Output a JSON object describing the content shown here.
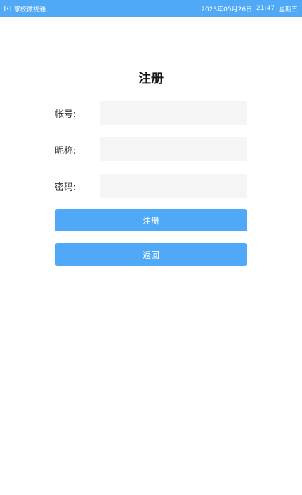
{
  "status_bar": {
    "app_icon": "app-logo-icon",
    "app_name": "家校微视通",
    "date": "2023年05月26日",
    "time": "21:47",
    "weekday": "星期五"
  },
  "page": {
    "title": "注册"
  },
  "form": {
    "account_label": "帐号:",
    "account_value": "",
    "nickname_label": "昵称:",
    "nickname_value": "",
    "password_label": "密码:",
    "password_value": "",
    "register_button": "注册",
    "back_button": "返回"
  },
  "colors": {
    "accent": "#4fa9f7",
    "input_background": "#f5f5f5"
  }
}
